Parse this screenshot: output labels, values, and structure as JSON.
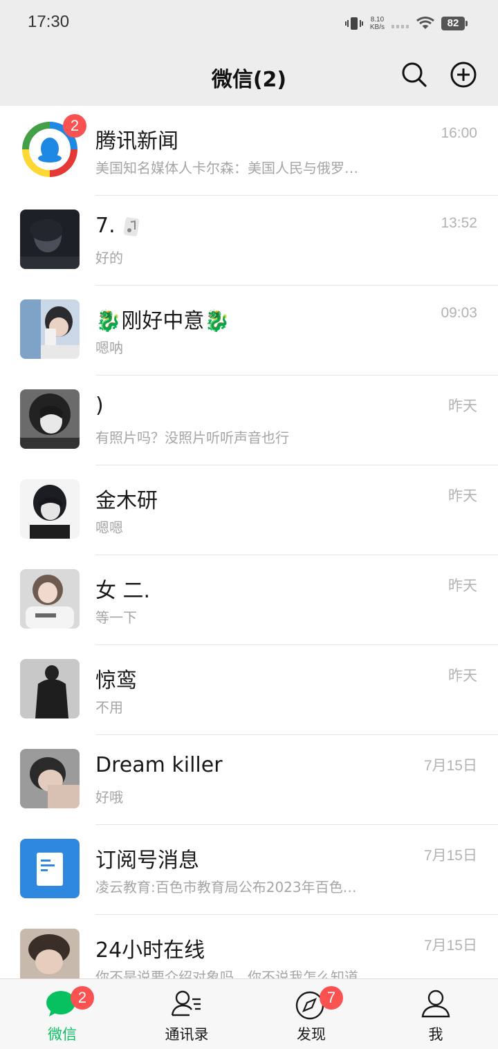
{
  "status": {
    "time": "17:30",
    "net_speed_value": "8.10",
    "net_speed_unit": "KB/s",
    "battery": "82"
  },
  "header": {
    "title": "微信(2)",
    "icons": [
      "search-icon",
      "add-icon"
    ]
  },
  "chats": [
    {
      "name": "腾讯新闻",
      "preview": "美国知名媒体人卡尔森：美国人民与俄罗…",
      "time": "16:00",
      "badge": "2"
    },
    {
      "name": "7.",
      "preview": "好的",
      "time": "13:52"
    },
    {
      "name": "刚好中意",
      "preview": "嗯呐",
      "time": "09:03"
    },
    {
      "name": ")",
      "preview": "有照片吗？没照片听听声音也行",
      "time": "昨天"
    },
    {
      "name": "金木研",
      "preview": "嗯嗯",
      "time": "昨天"
    },
    {
      "name": "女  二.",
      "preview": "等一下",
      "time": "昨天"
    },
    {
      "name": "惊鸾",
      "preview": "不用",
      "time": "昨天"
    },
    {
      "name": "Dream killer",
      "preview": "好哦",
      "time": "7月15日"
    },
    {
      "name": "订阅号消息",
      "preview": "凌云教育:百色市教育局公布2023年百色…",
      "time": "7月15日"
    },
    {
      "name": "24小时在线",
      "preview": "你不是说要介绍对象吗，你不说我怎么知道",
      "time": "7月15日"
    }
  ],
  "tabs": [
    {
      "label": "微信",
      "badge": "2"
    },
    {
      "label": "通讯录"
    },
    {
      "label": "发现",
      "badge": "7"
    },
    {
      "label": "我"
    }
  ],
  "colors": {
    "accent": "#07c160",
    "badge": "#fa5151",
    "header_bg": "#ededed"
  }
}
